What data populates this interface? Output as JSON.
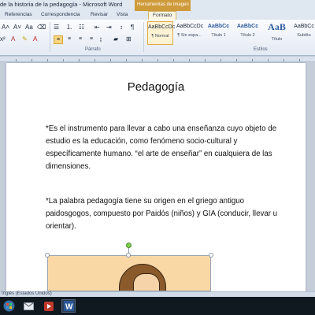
{
  "window": {
    "title": "de la historia de la pedagogía - Microsoft Word",
    "contextual_tab": "Herramientas de imagen"
  },
  "ribbon_tabs": [
    {
      "label": "Referencias"
    },
    {
      "label": "Correspondencia"
    },
    {
      "label": "Revisar"
    },
    {
      "label": "Vista"
    },
    {
      "label": "Formato"
    }
  ],
  "ribbon": {
    "paragraph_group_label": "Párrafo",
    "styles_group_label": "Estilos",
    "styles": [
      {
        "sample": "AaBbCcDc",
        "name": "¶ Normal"
      },
      {
        "sample": "AaBbCcDc",
        "name": "¶ Sin espa..."
      },
      {
        "sample": "AaBbCc",
        "name": "Título 1"
      },
      {
        "sample": "AaBbCc",
        "name": "Título 2"
      },
      {
        "sample": "AaB",
        "name": "Título"
      },
      {
        "sample": "AaBbCc",
        "name": "Subtítu"
      }
    ]
  },
  "document": {
    "title": "Pedagogía",
    "paragraph1": "*Es el instrumento para llevar a cabo una enseñanza cuyo objeto de estudio es la educación, como fenómeno socio-cultural y específicamente humano. “el arte de enseñar” en cualquiera de las dimensiones.",
    "paragraph2": "*La palabra pedagogía tiene su origen en el griego antiguo paidosgogos, compuesto por Paidós (niños)  y GIA (conducir, llevar u orientar)."
  },
  "statusbar": {
    "text": "Inglés (Estados Unidos)"
  },
  "colors": {
    "accent": "#cf9a3a",
    "selected_style": "#fdf3d3",
    "taskbar": "#101820"
  }
}
